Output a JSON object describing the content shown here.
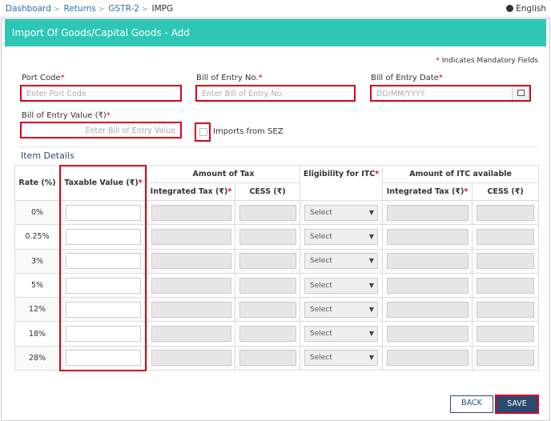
{
  "breadcrumb": {
    "items": [
      "Dashboard",
      "Returns",
      "GSTR-2"
    ],
    "current": "IMPG"
  },
  "language": "English",
  "header": {
    "title": "Import Of Goods/Capital Goods - Add"
  },
  "mandatory_note": "Indicates Mandatory Fields",
  "required_mark": "*",
  "fields": {
    "port_code": {
      "label": "Port Code",
      "placeholder": "Enter Port Code"
    },
    "bill_no": {
      "label": "Bill of Entry No.",
      "placeholder": "Enter Bill of Entry No."
    },
    "bill_date": {
      "label": "Bill of Entry Date",
      "placeholder": "DD/MM/YYYY"
    },
    "bill_value": {
      "label": "Bill of Entry Value (₹)",
      "placeholder": "Enter Bill of Entry Value"
    },
    "sez": {
      "label": "Imports from SEZ",
      "checked": false
    }
  },
  "item_details": {
    "title": "Item Details",
    "headers": {
      "rate": "Rate (%)",
      "taxable": "Taxable Value (₹)",
      "amount_tax": "Amount of Tax",
      "eligibility": "Eligibility for ITC",
      "amount_itc": "Amount of ITC available",
      "integrated_tax": "Integrated Tax (₹)",
      "cess": "CESS (₹)"
    },
    "select_placeholder": "Select",
    "rows": [
      {
        "rate": "0%"
      },
      {
        "rate": "0.25%"
      },
      {
        "rate": "3%"
      },
      {
        "rate": "5%"
      },
      {
        "rate": "12%"
      },
      {
        "rate": "18%"
      },
      {
        "rate": "28%"
      }
    ]
  },
  "buttons": {
    "back": "BACK",
    "save": "SAVE"
  },
  "colors": {
    "header": "#2ec7b5",
    "highlight": "#d9001b",
    "primary": "#2c4a70"
  }
}
